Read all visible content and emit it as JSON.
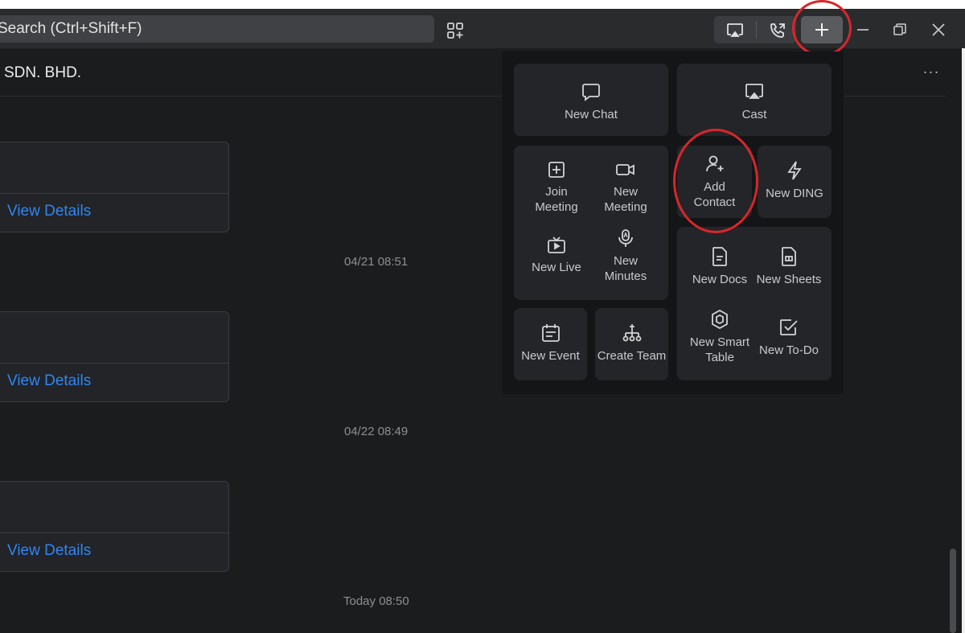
{
  "titlebar": {
    "search_placeholder": "Search (Ctrl+Shift+F)"
  },
  "chat": {
    "title": "SDN. BHD.",
    "cards": [
      {
        "link": "View Details"
      },
      {
        "link": "View Details"
      },
      {
        "link": "View Details"
      }
    ],
    "timestamps": [
      "04/21 08:51",
      "04/22 08:49",
      "Today 08:50"
    ]
  },
  "menu": {
    "new_chat": "New Chat",
    "cast": "Cast",
    "join_meeting": "Join\nMeeting",
    "new_meeting": "New\nMeeting",
    "new_live": "New Live",
    "new_minutes": "New\nMinutes",
    "add_contact": "Add\nContact",
    "new_ding": "New DING",
    "new_docs": "New Docs",
    "new_sheets": "New Sheets",
    "new_smart_table": "New Smart\nTable",
    "new_todo": "New To-Do",
    "new_event": "New Event",
    "create_team": "Create Team"
  },
  "colors": {
    "background": "#1b1c1e",
    "link": "#2f86f6",
    "annotation": "#d8262b"
  }
}
